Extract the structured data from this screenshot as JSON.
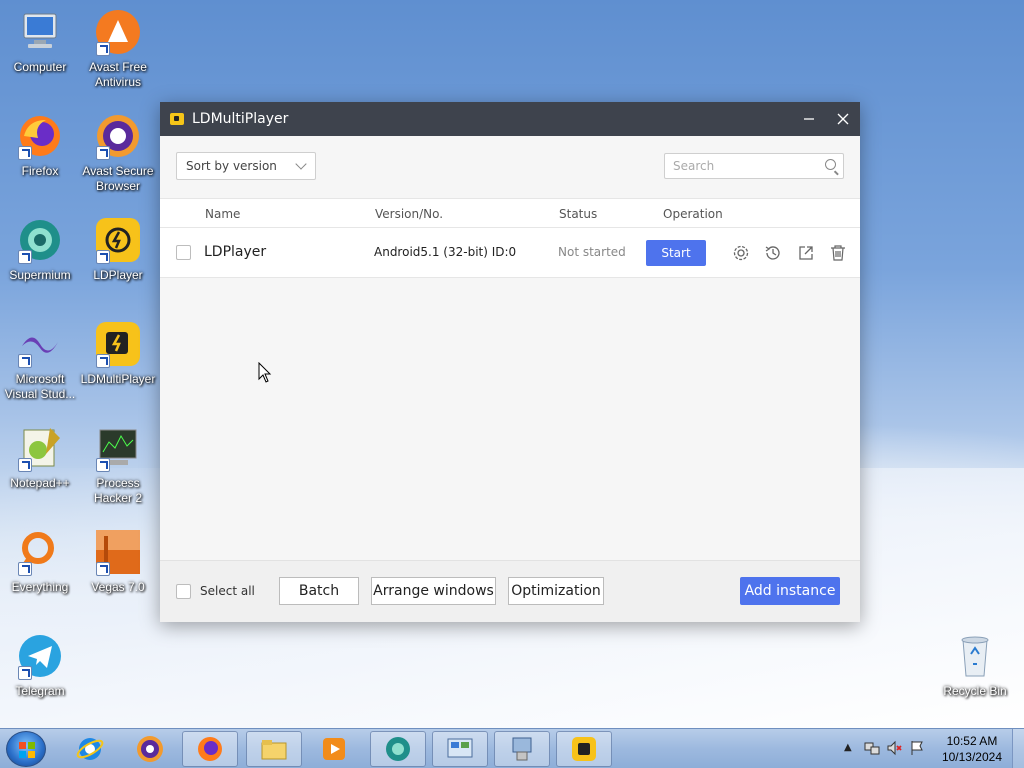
{
  "desktop": {
    "icons": [
      {
        "label": "Computer",
        "icon": "computer-icon"
      },
      {
        "label": "Avast Free Antivirus",
        "icon": "avast-icon"
      },
      {
        "label": "Firefox",
        "icon": "firefox-icon"
      },
      {
        "label": "Avast Secure Browser",
        "icon": "avast-browser-icon"
      },
      {
        "label": "Supermium",
        "icon": "supermium-icon"
      },
      {
        "label": "LDPlayer",
        "icon": "ldplayer-icon"
      },
      {
        "label": "Microsoft Visual Stud...",
        "icon": "visual-studio-icon"
      },
      {
        "label": "LDMultiPlayer",
        "icon": "ldmultiplayer-icon"
      },
      {
        "label": "Notepad++",
        "icon": "notepadpp-icon"
      },
      {
        "label": "Process Hacker 2",
        "icon": "process-hacker-icon"
      },
      {
        "label": "Everything",
        "icon": "everything-icon"
      },
      {
        "label": "Vegas 7.0",
        "icon": "vegas-icon"
      },
      {
        "label": "Telegram",
        "icon": "telegram-icon"
      },
      {
        "label": "Recycle Bin",
        "icon": "recycle-bin-icon"
      }
    ]
  },
  "window": {
    "title": "LDMultiPlayer",
    "sort_label": "Sort by version",
    "search_placeholder": "Search",
    "columns": {
      "name": "Name",
      "version": "Version/No.",
      "status": "Status",
      "operation": "Operation"
    },
    "rows": [
      {
        "name": "LDPlayer",
        "version": "Android5.1 (32-bit) ID:0",
        "status": "Not started",
        "start_label": "Start"
      }
    ],
    "footer": {
      "select_all": "Select all",
      "batch": "Batch",
      "arrange": "Arrange windows",
      "optimization": "Optimization",
      "add_instance": "Add instance"
    },
    "colors": {
      "accent": "#4e73ed",
      "titlebar": "#3e434d"
    }
  },
  "taskbar": {
    "items": [
      "internet-explorer-icon",
      "avast-browser-icon",
      "firefox-icon",
      "file-explorer-icon",
      "media-player-icon",
      "supermium-icon",
      "control-panel-icon",
      "network-tool-icon",
      "ldmultiplayer-icon"
    ],
    "time": "10:52 AM",
    "date": "10/13/2024"
  }
}
